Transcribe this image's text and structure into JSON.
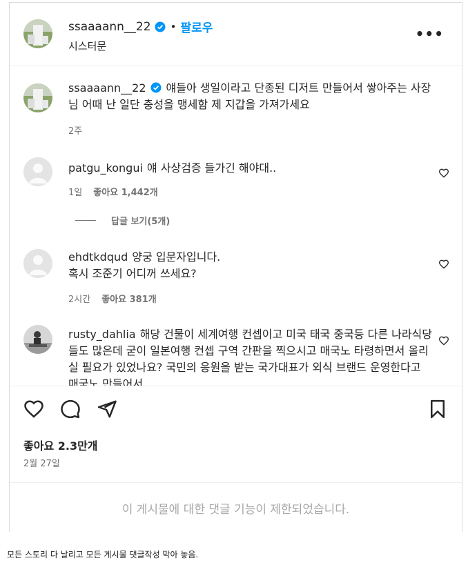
{
  "post": {
    "author": "ssaaaann__22",
    "follow_label": "팔로우",
    "dot": "•",
    "location": "시스터문",
    "more": "•••"
  },
  "caption": {
    "username": "ssaaaann__22",
    "text": "얘들아 생일이라고 단종된 디저트 만들어서 쌓아주는 사장님 어때 난 일단 충성을 맹세함 제 지갑을 가져가세요",
    "time": "2주"
  },
  "comments": [
    {
      "username": "patgu_kongui",
      "text": "얘 사상검증 들가긴 해야대..",
      "time": "1일",
      "likes": "좋아요 1,442개"
    },
    {
      "username": "ehdtkdqud",
      "text": "양궁 입문자입니다.\n혹시 조준기 어디꺼 쓰세요?",
      "time": "2시간",
      "likes": "좋아요 381개"
    },
    {
      "username": "rusty_dahlia",
      "text": "해당 건물이 세계여행 컨셉이고 미국 태국 중국등 다른 나라식당들도 많은데 굳이 일본여행 컨셉 구역 간판을 찍으시고 매국노 타령하면서 올리실 필요가 있었나요? 국민의 응원을 받는 국가대표가 외식 브랜드 운영한다고 매국노 만들어서"
    }
  ],
  "replies_label": "답글 보기(5개)",
  "actions": {
    "likes_total": "좋아요 2.3만개",
    "date": "2월 27일"
  },
  "restricted_notice": "이 게시물에 대한 댓글 기능이 제한되었습니다.",
  "footnote": "모든 스토리 다 날리고 모든 게시물 댓글작성 막아 놓음.",
  "colors": {
    "accent": "#0095f6",
    "text": "#262626",
    "muted": "#737373",
    "border": "#dbdbdb"
  },
  "icons": [
    "verified-badge-icon",
    "more-options-icon",
    "heart-icon",
    "comment-icon",
    "share-icon",
    "bookmark-icon"
  ]
}
